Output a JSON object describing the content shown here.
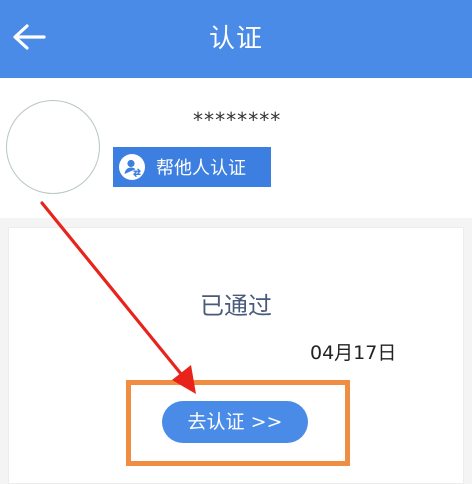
{
  "header": {
    "title": "认证",
    "back_icon": "arrow-left-icon"
  },
  "profile": {
    "masked_name": "********",
    "help_button_label": "帮他人认证",
    "help_button_icon": "user-switch-icon"
  },
  "card": {
    "status": "已通过",
    "date": "04月17日",
    "action_button_label": "去认证 >>"
  },
  "colors": {
    "primary": "#4a8be8",
    "highlight": "#ef8e42",
    "annotation_arrow": "#e8231c"
  }
}
